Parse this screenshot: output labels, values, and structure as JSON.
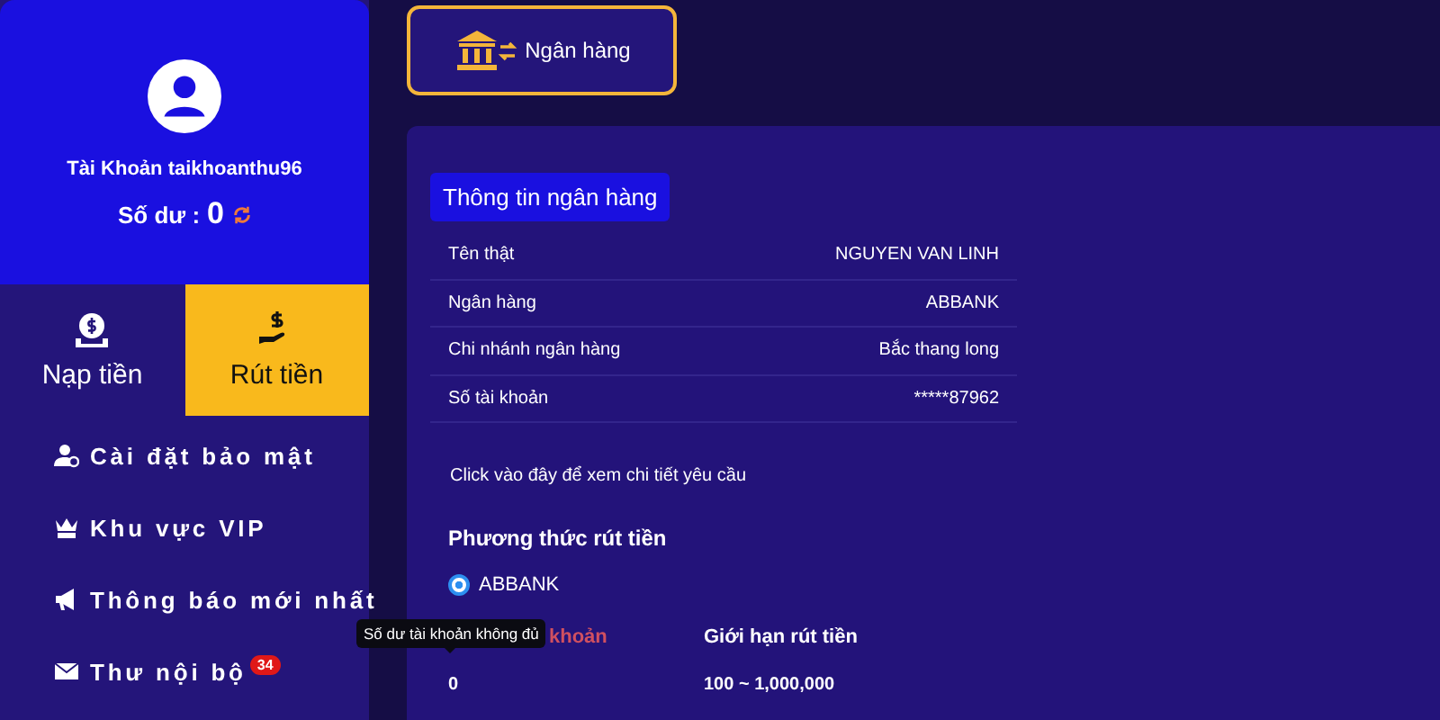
{
  "profile": {
    "account_label": "Tài Khoản taikhoanthu96",
    "balance_label": "Số dư :",
    "balance": "0"
  },
  "actions": [
    {
      "kind": "deposit",
      "label": "Nạp tiền",
      "selected": false
    },
    {
      "kind": "withdraw",
      "label": "Rút tiền",
      "selected": true
    }
  ],
  "menu": [
    {
      "kind": "security",
      "label": "Cài đặt bảo mật"
    },
    {
      "kind": "vip",
      "label": "Khu vực VIP"
    },
    {
      "kind": "notice",
      "label": "Thông báo mới nhất"
    },
    {
      "kind": "mail",
      "label": "Thư nội bộ",
      "badge": "34"
    }
  ],
  "tabs": [
    {
      "label": "Ngân hàng",
      "selected": true
    }
  ],
  "bank_info": {
    "title": "Thông tin ngân hàng",
    "rows": [
      {
        "label": "Tên thật",
        "value": "NGUYEN VAN LINH"
      },
      {
        "label": "Ngân hàng",
        "value": "ABBANK"
      },
      {
        "label": "Chi nhánh ngân hàng",
        "value": "Bắc thang long"
      },
      {
        "label": "Số tài khoản",
        "value": "*****87962"
      }
    ]
  },
  "detail_link": "Click vào đây để xem chi tiết yêu cầu",
  "method": {
    "title": "Phương thức rút tiền",
    "options": [
      {
        "label": "ABBANK",
        "selected": true
      }
    ]
  },
  "limits": [
    {
      "label": "khoản",
      "value": "0",
      "kind": "warning"
    },
    {
      "label": "Giới hạn rút tiền",
      "value": "100 ~ 1,000,000",
      "kind": "normal"
    }
  ],
  "tooltip": "Số dư tài khoản không đủ"
}
